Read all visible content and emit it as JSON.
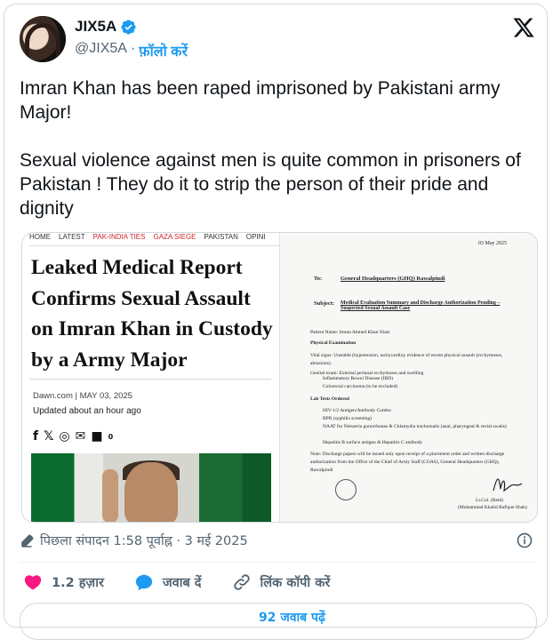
{
  "user": {
    "name": "JIX5A",
    "handle": "@JIX5A",
    "separator": "·",
    "follow_label": "फ़ॉलो करें"
  },
  "tweet": {
    "text": "Imran Khan has been raped imprisoned by Pakistani army Major!\n\nSexual violence against men is quite common in prisoners of Pakistan ! They do it to strip the person of their pride and dignity"
  },
  "media_left": {
    "nav": [
      "HOME",
      "LATEST",
      "PAK-INDIA TIES",
      "GAZA SIEGE",
      "PAKISTAN",
      "OPINI"
    ],
    "headline": "Leaked Medical Report Confirms Sexual Assault on Imran Khan in Custody by a Army Major",
    "source": "Dawn.com | MAY 03, 2025",
    "updated": "Updated about an hour ago",
    "comment_count": "0"
  },
  "media_right": {
    "date": "03 May 2025",
    "to_label": "To:",
    "to_value": "General Headquarters (GHQ) Rawalpindi",
    "subject_label": "Subject:",
    "subject_value": "Medical Evaluation Summary and Discharge Authorization Pending – Suspected Sexual Assault Case",
    "patient": "Patient Name: Imran Ahmed Khan Niazi",
    "physical": "Physical Examination",
    "vital": "Vital signs: Unstable (hypotension, tachycardia); evidence of recent physical assault (ecchymoses, abrasions).",
    "genital": "Genital exam: External perianal ecchymoses and swelling",
    "ibd": "Inflammatory Bowel Disease (IBD)",
    "crc": "Colorectal carcinoma (to be excluded)",
    "lab": "Lab Tests Ordered",
    "tests": [
      "HIV-1/2 Antigen/Antibody Combo",
      "RPR (syphilis screening)",
      "NAAT for Neisseria gonorrhoeae & Chlamydia trachomatis (anal, pharyngeal & rectal swabs)",
      "Hepatitis B surface antigen & Hepatitis C antibody"
    ],
    "note": "Note: Discharge papers will be issued only upon receipt of a placement order and written discharge authorization from the Office of the Chief of Army Staff (COAS), General Headquarters (GHQ), Rawalpindi",
    "rank": "Lt.Col. (Retd)",
    "signee": "(Muhammad Khalid Rafique Shah)"
  },
  "meta": {
    "edited": "पिछला संपादन 1:58 पूर्वाह्न · 3 मई 2025"
  },
  "actions": {
    "likes": "1.2 हज़ार",
    "reply": "जवाब दें",
    "copy_link": "लिंक कॉपी करें"
  },
  "bottom": {
    "label": "92 जवाब पढ़ें"
  },
  "colors": {
    "accent": "#1d9bf0",
    "like": "#f91880",
    "text": "#0f1419",
    "muted": "#536471"
  }
}
